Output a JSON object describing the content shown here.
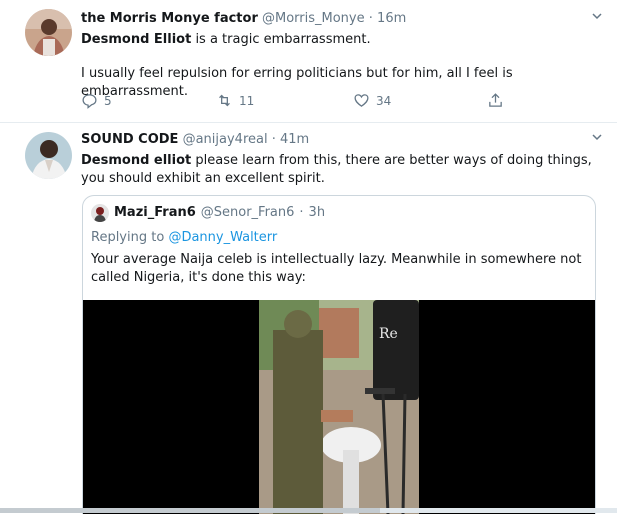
{
  "tweets": [
    {
      "name": "the Morris Monye factor",
      "handle": "@Morris_Monye",
      "separator": "·",
      "time": "16m",
      "text_bold": "Desmond Elliot",
      "text_rest": " is a tragic embarrassment.",
      "text2": "I usually feel repulsion for erring politicians but for him, all I feel is embarrassment.",
      "replies": "5",
      "retweets": "11",
      "likes": "34"
    },
    {
      "name": "SOUND CODE",
      "handle": "@anijay4real",
      "separator": "·",
      "time": "41m",
      "text_bold": "Desmond elliot",
      "text_rest": " please learn from this, there are better ways of doing things, you should exhibit an excellent spirit.",
      "quote": {
        "name": "Mazi_Fran6",
        "handle": "@Senor_Fran6",
        "separator": "·",
        "time": "3h",
        "replying_prefix": "Replying to ",
        "replying_to": "@Danny_Walterr",
        "text": "Your average Naija celeb is intellectually lazy. Meanwhile in somewhere not called Nigeria, it's done this way:",
        "media_tank_text": "Re"
      }
    }
  ],
  "icons": {
    "reply": "reply-icon",
    "retweet": "retweet-icon",
    "like": "like-icon",
    "share": "share-icon",
    "chevron": "chevron-down-icon"
  },
  "colors": {
    "text": "#14171a",
    "secondary": "#657786",
    "link": "#1b95e0",
    "border": "#e6ecf0"
  }
}
